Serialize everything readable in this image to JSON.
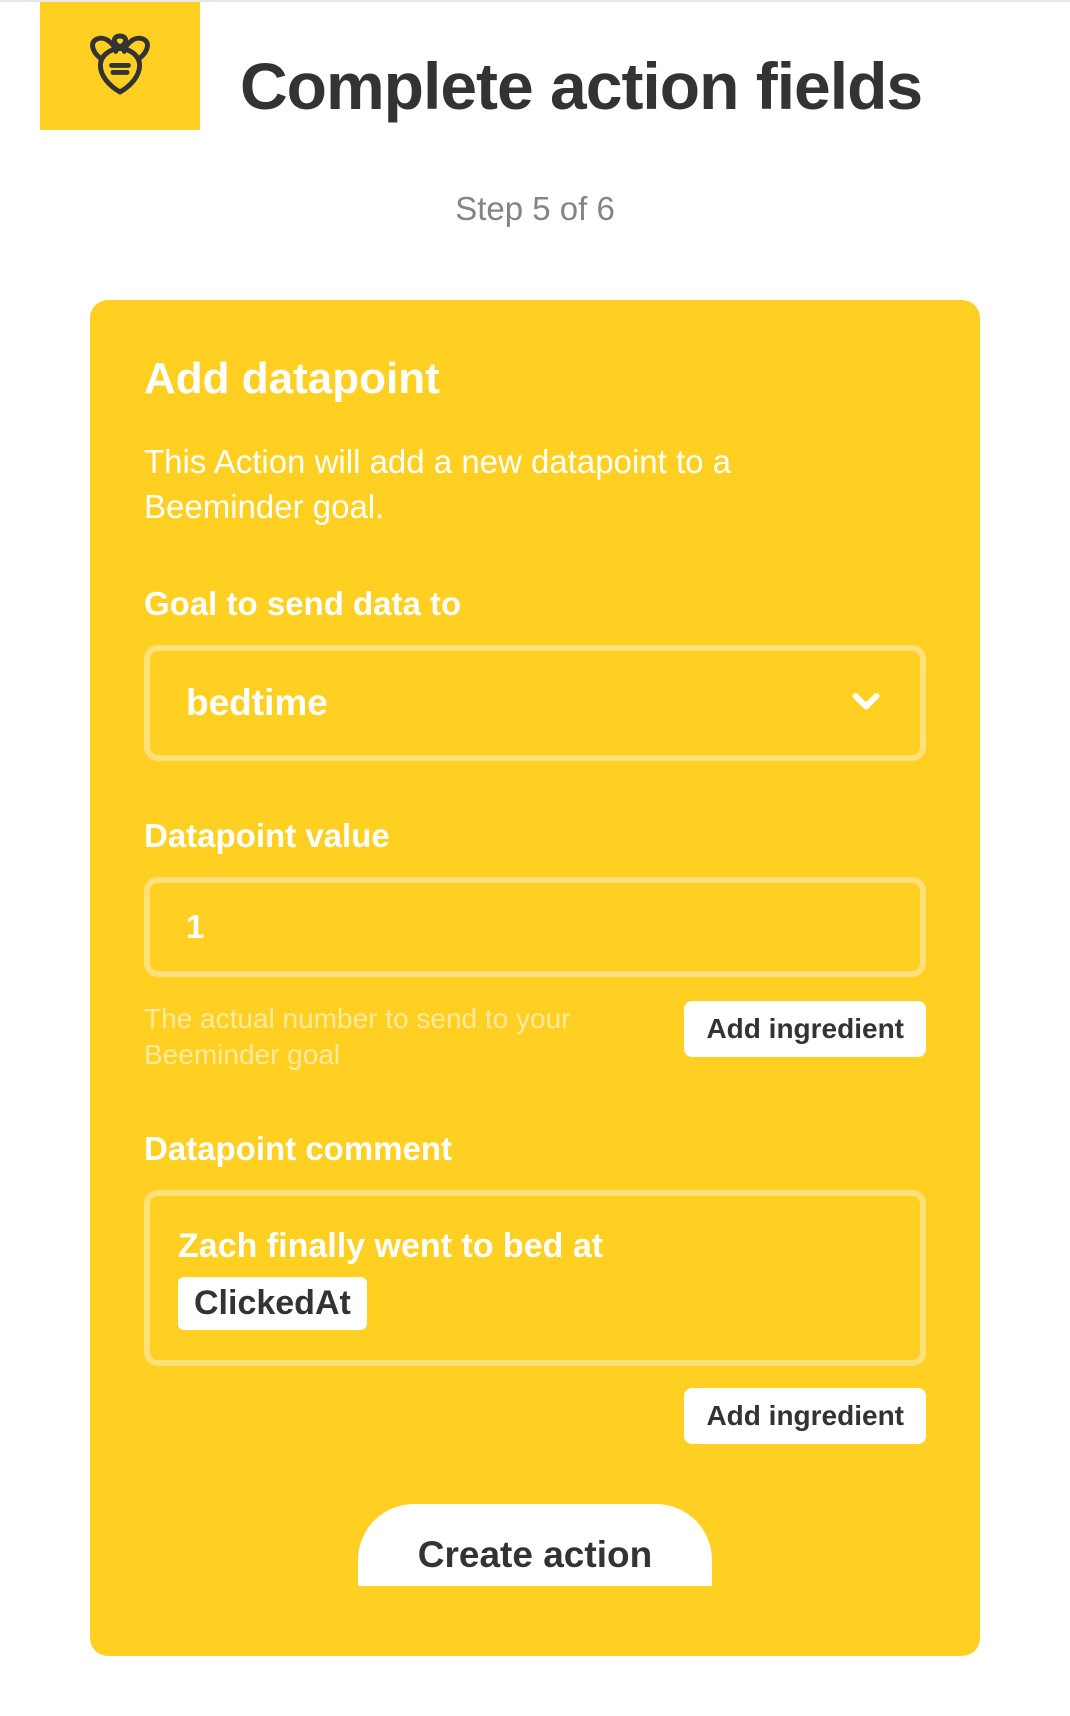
{
  "header": {
    "title": "Complete action fields",
    "step_text": "Step 5 of 6"
  },
  "card": {
    "title": "Add datapoint",
    "description": "This Action will add a new datapoint to a Beeminder goal.",
    "goal": {
      "label": "Goal to send data to",
      "selected": "bedtime"
    },
    "value": {
      "label": "Datapoint value",
      "value": "1",
      "helper": "The actual number to send to your Beeminder goal",
      "add_ingredient": "Add ingredient"
    },
    "comment": {
      "label": "Datapoint comment",
      "text": "Zach finally went to bed at",
      "chip": "ClickedAt",
      "add_ingredient": "Add ingredient"
    },
    "create_label": "Create action"
  }
}
